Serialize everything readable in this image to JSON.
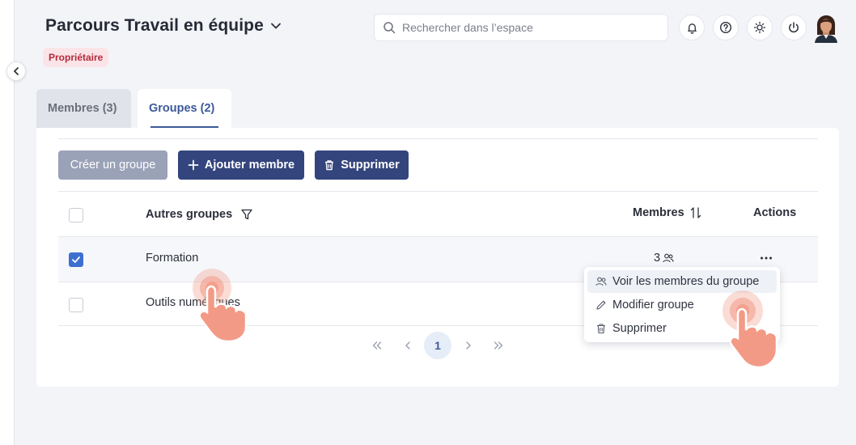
{
  "header": {
    "title": "Parcours Travail en équipe",
    "role_badge": "Propriétaire"
  },
  "search": {
    "placeholder": "Rechercher dans l’espace"
  },
  "top_icons": [
    "bell-icon",
    "help-icon",
    "sun-icon",
    "power-icon"
  ],
  "tabs": [
    {
      "label": "Membres (3)",
      "active": false
    },
    {
      "label": "Groupes (2)",
      "active": true
    }
  ],
  "toolbar": {
    "create_label": "Créer un groupe",
    "add_label": "Ajouter membre",
    "delete_label": "Supprimer"
  },
  "table": {
    "col_groups": "Autres groupes",
    "col_members": "Membres",
    "col_actions": "Actions",
    "rows": [
      {
        "name": "Formation",
        "members": "3",
        "checked": true
      },
      {
        "name": "Outils numériques",
        "members": "",
        "checked": false
      }
    ]
  },
  "pagination": {
    "current": "1"
  },
  "context_menu": {
    "items": [
      {
        "label": "Voir les membres du groupe",
        "icon": "users-icon"
      },
      {
        "label": "Modifier groupe",
        "icon": "pencil-icon"
      },
      {
        "label": "Supprimer",
        "icon": "trash-icon"
      }
    ]
  },
  "colors": {
    "primary": "#34457d",
    "accent_blue": "#3d5a99",
    "badge_bg": "#fbe4e7",
    "badge_text": "#b42a3d",
    "hand": "#f29a86"
  }
}
